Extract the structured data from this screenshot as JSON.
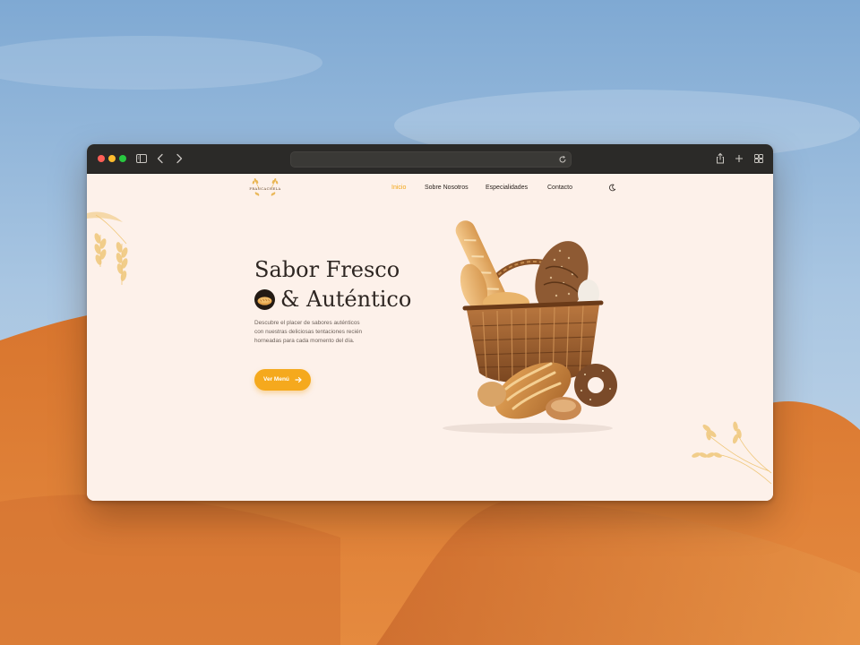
{
  "browser": {
    "address_value": "",
    "icons": [
      "sidebar-icon",
      "back-icon",
      "forward-icon",
      "reload-icon",
      "share-icon",
      "new-tab-icon",
      "tab-overview-icon"
    ]
  },
  "site": {
    "logo_text": "FRANCACHELA",
    "nav": [
      {
        "label": "Inicio",
        "active": true
      },
      {
        "label": "Sobre Nosotros",
        "active": false
      },
      {
        "label": "Especialidades",
        "active": false
      },
      {
        "label": "Contacto",
        "active": false
      }
    ],
    "theme_toggle_icon": "moon-icon"
  },
  "hero": {
    "title_line1": "Sabor Fresco",
    "title_line2": "& Auténtico",
    "description": "Descubre el placer de sabores auténticos con nuestras deliciosas tentaciones recién horneadas para cada momento del día.",
    "cta_label": "Ver Menú"
  },
  "colors": {
    "accent": "#f5a91d",
    "page_background": "#fdf1ea",
    "heading": "#2e2622",
    "toolbar": "#2b2a28"
  }
}
